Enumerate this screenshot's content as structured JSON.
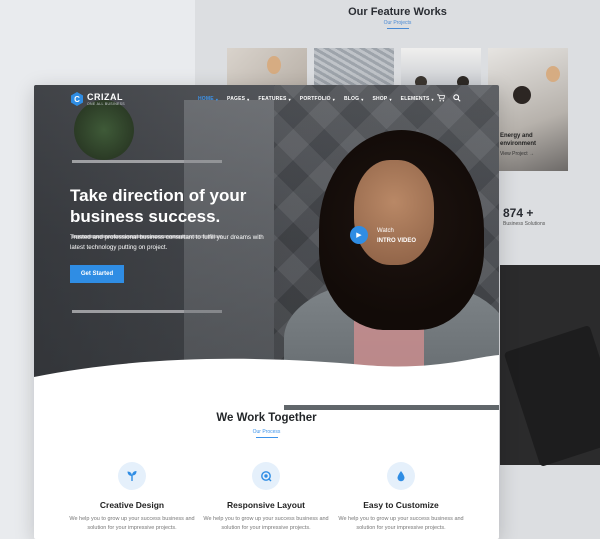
{
  "bg": {
    "title": "Our Feature Works",
    "subtitle": "Our Projects",
    "card_title": "Energy and environment",
    "card_link": "View Project →",
    "stat_value": "874 +",
    "stat_label": "Business Solutions"
  },
  "header": {
    "brand": "CRIZAL",
    "tagline": "ONE ALL BUSINESS",
    "nav": [
      {
        "label": "HOME"
      },
      {
        "label": "PAGES"
      },
      {
        "label": "FEATURES"
      },
      {
        "label": "PORTFOLIO"
      },
      {
        "label": "BLOG"
      },
      {
        "label": "SHOP"
      },
      {
        "label": "ELEMENTS"
      }
    ]
  },
  "hero": {
    "headline": "Take direction of your business success.",
    "lead": "Trusted and professional business consultant to fulfill your dreams with latest technology putting on project.",
    "cta": "Get Started",
    "video_top": "Watch",
    "video_bottom": "INTRO VIDEO"
  },
  "section": {
    "title": "We Work Together",
    "subtitle": "Our Process"
  },
  "features": [
    {
      "title": "Creative Design",
      "desc": "We help you to grow up your success business and solution for your impressive projects.",
      "icon": "sprout-icon"
    },
    {
      "title": "Responsive Layout",
      "desc": "We help you to grow up your success business and solution for your impressive projects.",
      "icon": "responsive-icon"
    },
    {
      "title": "Easy to Customize",
      "desc": "We help you to grow up your success business and solution for your impressive projects.",
      "icon": "drop-icon"
    }
  ],
  "colors": {
    "accent": "#2f8de4"
  }
}
